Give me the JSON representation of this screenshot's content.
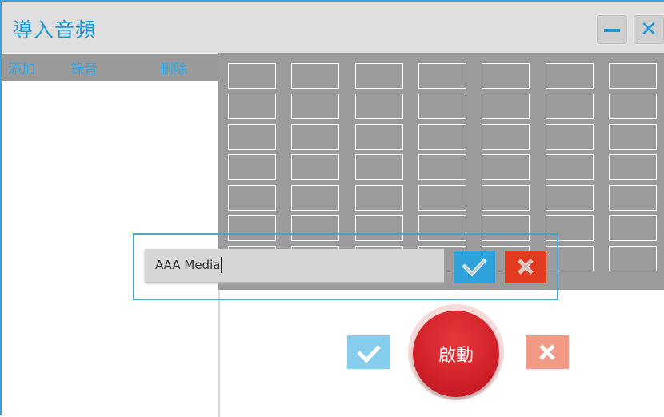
{
  "window": {
    "title": "導入音頻",
    "minimize_icon": "minimize-icon",
    "close_glyph": "✕"
  },
  "left_panel": {
    "toolbar": {
      "add_label": "添加",
      "record_label": "錄音",
      "delete_label": "刪除"
    }
  },
  "grid": {
    "columns": 7,
    "rows": 7
  },
  "name_dialog": {
    "input_value": "AAA Media",
    "confirm_icon": "checkmark-icon",
    "cancel_icon": "close-icon"
  },
  "footer": {
    "start_label": "啟動",
    "confirm_icon": "checkmark-icon",
    "cancel_icon": "close-icon"
  },
  "colors": {
    "accent_blue": "#1f9ad6",
    "grid_gray": "#9b9b9b",
    "cancel_red": "#e23a1f",
    "start_red": "#d02029"
  }
}
